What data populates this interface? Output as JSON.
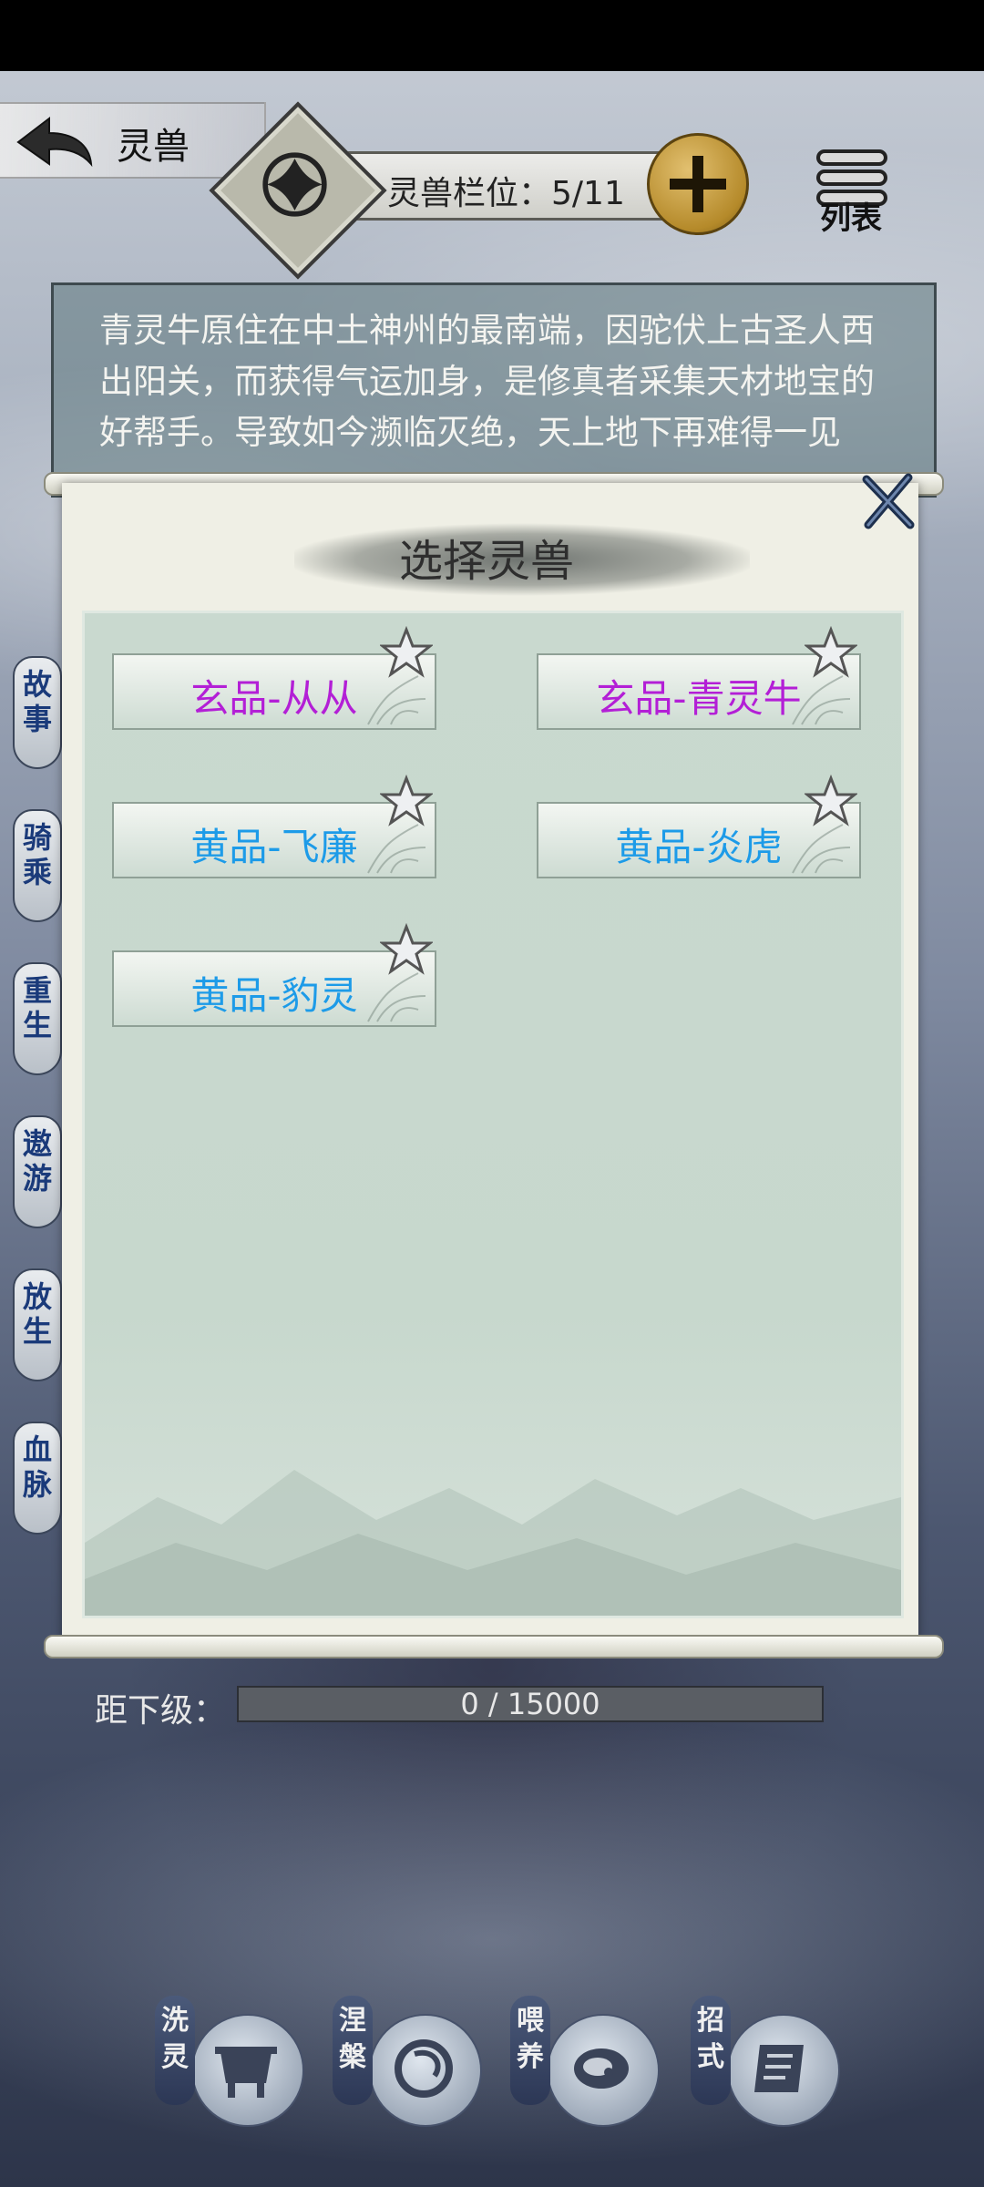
{
  "header": {
    "back_title": "灵兽",
    "slot_label": "灵兽栏位：5/11",
    "list_label": "列表"
  },
  "description": "青灵牛原住在中土神州的最南端，因驼伏上古圣人西出阳关，而获得气运加身，是修真者采集天材地宝的好帮手。导致如今濒临灭绝，天上地下再难得一见",
  "side_tabs": [
    {
      "line1": "故",
      "line2": "事"
    },
    {
      "line1": "骑",
      "line2": "乘"
    },
    {
      "line1": "重",
      "line2": "生"
    },
    {
      "line1": "遨",
      "line2": "游"
    },
    {
      "line1": "放",
      "line2": "生"
    },
    {
      "line1": "血",
      "line2": "脉"
    }
  ],
  "dialog": {
    "title": "选择灵兽",
    "beasts": [
      {
        "name": "玄品-从从",
        "color": "#b31fd6"
      },
      {
        "name": "玄品-青灵牛",
        "color": "#b31fd6"
      },
      {
        "name": "黄品-飞廉",
        "color": "#1d9be8"
      },
      {
        "name": "黄品-炎虎",
        "color": "#1d9be8"
      },
      {
        "name": "黄品-豹灵",
        "color": "#1d9be8"
      }
    ]
  },
  "progress": {
    "label": "距下级：",
    "text": "0 / 15000",
    "value": 0
  },
  "actions": [
    {
      "line1": "洗",
      "line2": "灵",
      "icon": "cauldron-icon"
    },
    {
      "line1": "涅",
      "line2": "槃",
      "icon": "dragon-icon"
    },
    {
      "line1": "喂",
      "line2": "养",
      "icon": "meat-icon"
    },
    {
      "line1": "招",
      "line2": "式",
      "icon": "scroll-icon"
    }
  ]
}
